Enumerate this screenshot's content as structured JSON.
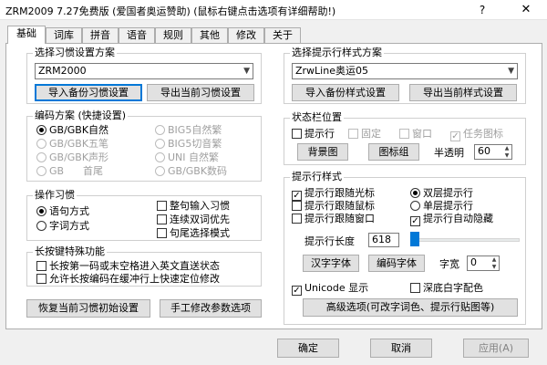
{
  "window": {
    "title": "ZRM2009 7.27免费版 (爱国者奥运赞助)   (鼠标右键点击选项有详细帮助!)",
    "help_glyph": "?",
    "close_glyph": "✕"
  },
  "tabs": [
    {
      "label": "基础",
      "active": true
    },
    {
      "label": "词库"
    },
    {
      "label": "拼音"
    },
    {
      "label": "语音"
    },
    {
      "label": "规则"
    },
    {
      "label": "其他"
    },
    {
      "label": "修改"
    },
    {
      "label": "关于"
    }
  ],
  "habit_scheme": {
    "group_label": "选择习惯设置方案",
    "combo_value": "ZRM2000",
    "import_button": "导入备份习惯设置",
    "export_button": "导出当前习惯设置"
  },
  "encoding": {
    "group_label": "编码方案 (快捷设置)",
    "options": [
      {
        "label": "GB/GBK自然",
        "checked": true,
        "disabled": false
      },
      {
        "label": "BIG5自然繁",
        "checked": false,
        "disabled": true
      },
      {
        "label": "GB/GBK五笔",
        "checked": false,
        "disabled": true
      },
      {
        "label": "BIG5切音繁",
        "checked": false,
        "disabled": true
      },
      {
        "label": "GB/GBK声形",
        "checked": false,
        "disabled": true
      },
      {
        "label": "UNI 自然繁",
        "checked": false,
        "disabled": true
      },
      {
        "label": "GB      首尾",
        "checked": false,
        "disabled": true
      },
      {
        "label": "GB/GBK数码",
        "checked": false,
        "disabled": true
      }
    ]
  },
  "operation": {
    "group_label": "操作习惯",
    "radios": [
      {
        "label": "语句方式",
        "checked": true
      },
      {
        "label": "字词方式",
        "checked": false
      }
    ],
    "checkboxes": [
      {
        "label": "整句输入习惯",
        "checked": false
      },
      {
        "label": "连续双词优先",
        "checked": false
      },
      {
        "label": "句尾选择模式",
        "checked": false
      }
    ]
  },
  "long_press": {
    "group_label": "长按键特殊功能",
    "checkboxes": [
      {
        "label": "长按第一码或末空格进入英文直送状态",
        "checked": false
      },
      {
        "label": "允许长按编码在缓冲行上快速定位修改",
        "checked": false
      }
    ]
  },
  "left_buttons": {
    "restore": "恢复当前习惯初始设置",
    "manual": "手工修改参数选项"
  },
  "prompt_scheme": {
    "group_label": "选择提示行样式方案",
    "combo_value": "ZrwLine奥运05",
    "import_button": "导入备份样式设置",
    "export_button": "导出当前样式设置"
  },
  "statusbar": {
    "group_label": "状态栏位置",
    "checkboxes": [
      {
        "label": "提示行",
        "checked": false,
        "disabled": false
      },
      {
        "label": "固定",
        "checked": false,
        "disabled": true
      },
      {
        "label": "窗口",
        "checked": false,
        "disabled": true
      },
      {
        "label": "任务图标",
        "checked": true,
        "disabled": true
      }
    ],
    "bg_button": "背景图",
    "icon_button": "图标组",
    "transparency_label": "半透明",
    "transparency_value": "60"
  },
  "prompt_style": {
    "group_label": "提示行样式",
    "left_checks": [
      {
        "label": "提示行跟随光标",
        "checked": true
      },
      {
        "label": "提示行跟随鼠标",
        "checked": false
      },
      {
        "label": "提示行跟随窗口",
        "checked": false
      }
    ],
    "radios": [
      {
        "label": "双层提示行",
        "checked": true
      },
      {
        "label": "单层提示行",
        "checked": false
      }
    ],
    "auto_hide": {
      "label": "提示行自动隐藏",
      "checked": true
    },
    "length_label": "提示行长度",
    "length_value": "618",
    "slider_fraction": 0.0,
    "hanzi_font_button": "汉字字体",
    "code_font_button": "编码字体",
    "spacing_label": "字宽",
    "spacing_value": "0",
    "unicode": {
      "label": "Unicode 显示",
      "checked": true
    },
    "dark_bg": {
      "label": "深底白字配色",
      "checked": false
    },
    "advanced_button": "高级选项(可改字词色、提示行贴图等)"
  },
  "footer": {
    "ok": "确定",
    "cancel": "取消",
    "apply": "应用(A)"
  }
}
